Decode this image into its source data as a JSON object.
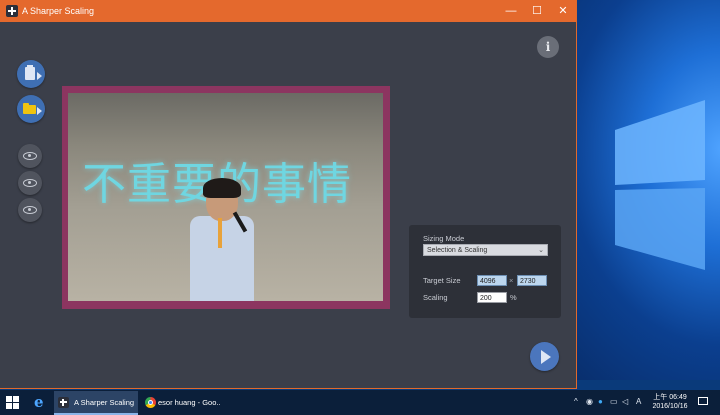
{
  "window": {
    "title": "A Sharper Scaling",
    "controls": {
      "minimize": "—",
      "maximize": "☐",
      "close": "✕"
    }
  },
  "info_button": {
    "label": "i"
  },
  "image": {
    "projected_text": "不重要的事情"
  },
  "settings": {
    "sizing_mode_label": "Sizing Mode",
    "sizing_mode_value": "Selection & Scaling",
    "sizing_mode_arrow": "⌄",
    "target_size_label": "Target Size",
    "target_width": "4096",
    "times_symbol": "×",
    "target_height": "2730",
    "scaling_label": "Scaling",
    "scaling_value": "200",
    "percent_symbol": "%"
  },
  "taskbar": {
    "tasks": [
      {
        "label": "A Sharper Scaling"
      },
      {
        "label": "esor huang - Goo..."
      }
    ],
    "tray": {
      "chevron": "^",
      "ime": "A"
    },
    "clock_line1": "上午 06:49",
    "clock_line2": "2016/10/16"
  },
  "colors": {
    "titlebar": "#e4692d",
    "window_bg": "#3b3f4a",
    "accent_blue": "#3f6fb3",
    "frame": "#8c3560",
    "projected_text": "#6fd6e1"
  }
}
